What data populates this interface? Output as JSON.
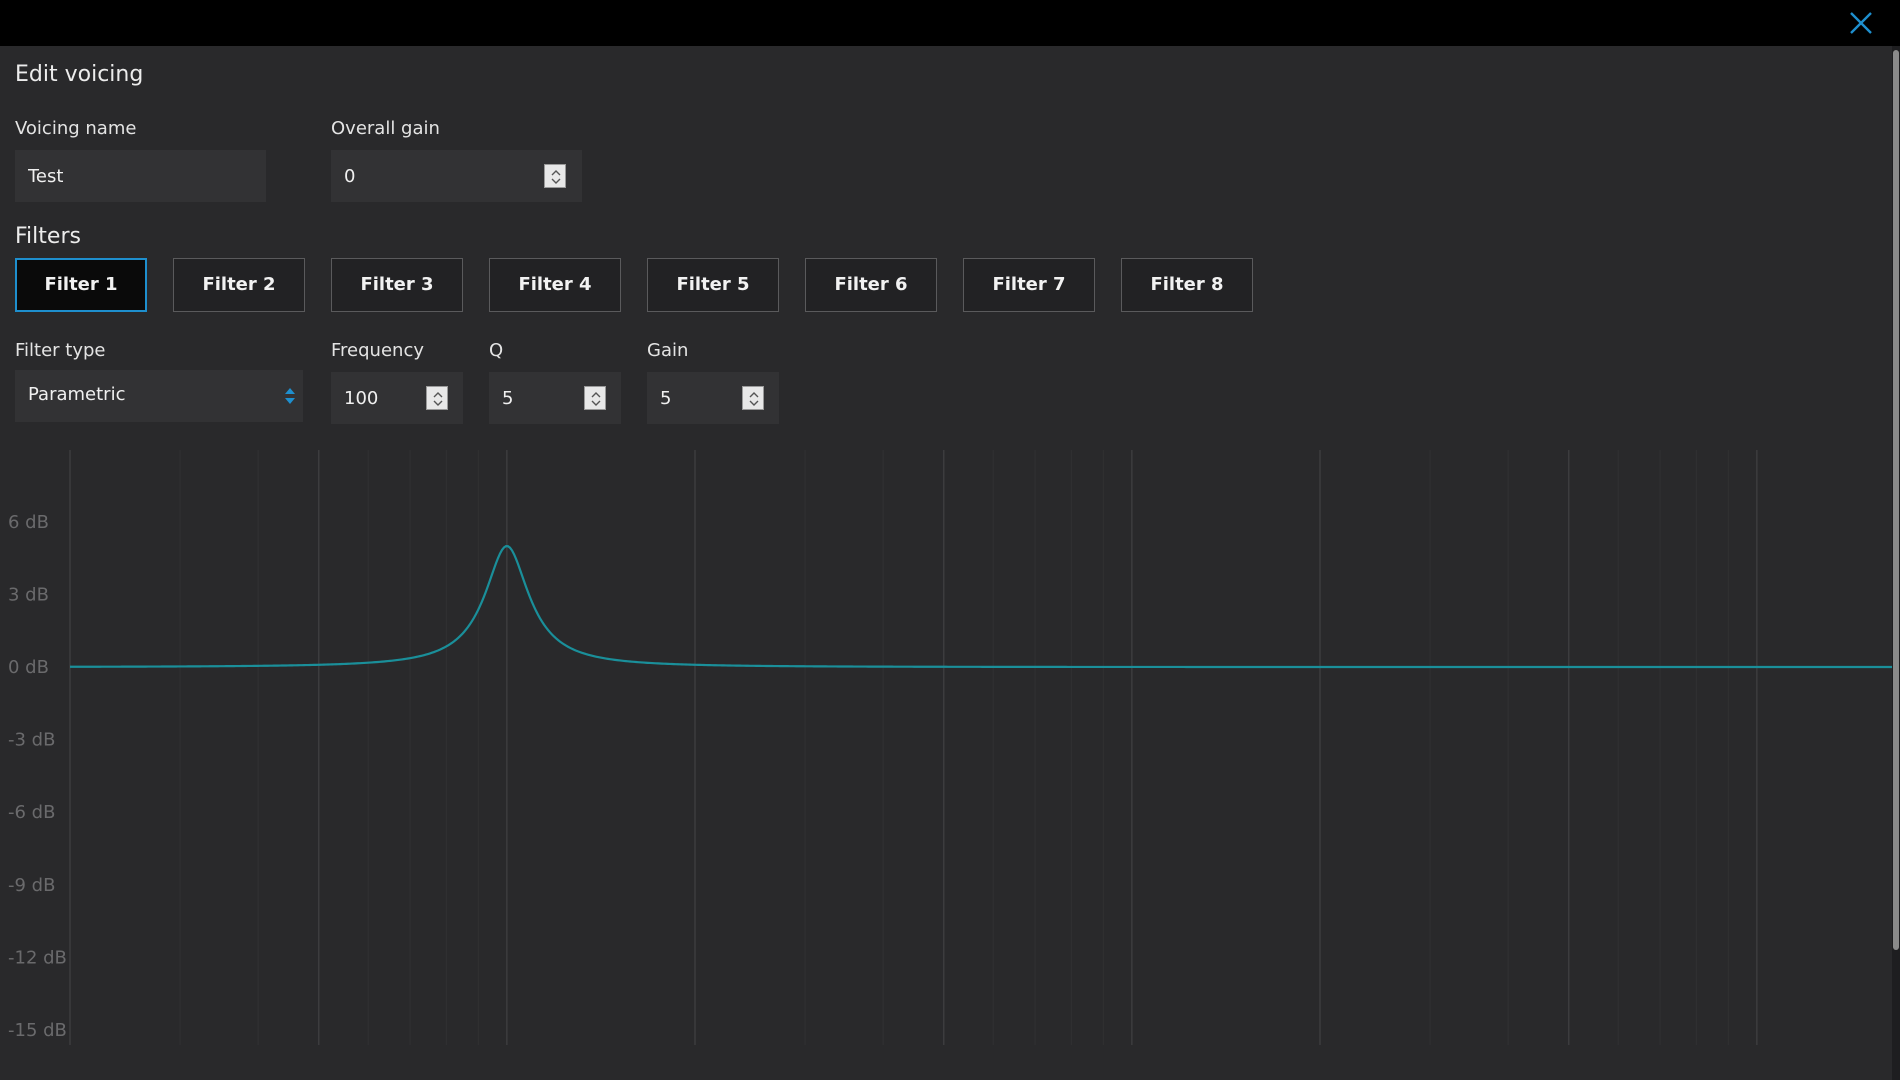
{
  "dialog": {
    "title": "Edit voicing",
    "close_icon": "close-icon"
  },
  "voicing": {
    "name_label": "Voicing name",
    "name_value": "Test",
    "gain_label": "Overall gain",
    "gain_value": "0"
  },
  "filters": {
    "heading": "Filters",
    "tabs": [
      {
        "label": "Filter 1",
        "active": true
      },
      {
        "label": "Filter 2",
        "active": false
      },
      {
        "label": "Filter 3",
        "active": false
      },
      {
        "label": "Filter 4",
        "active": false
      },
      {
        "label": "Filter 5",
        "active": false
      },
      {
        "label": "Filter 6",
        "active": false
      },
      {
        "label": "Filter 7",
        "active": false
      },
      {
        "label": "Filter 8",
        "active": false
      }
    ],
    "type_label": "Filter type",
    "type_value": "Parametric",
    "frequency_label": "Frequency",
    "frequency_value": "100",
    "q_label": "Q",
    "q_value": "5",
    "gain_label": "Gain",
    "gain_value": "5"
  },
  "colors": {
    "accent": "#1e8fce",
    "curve": "#1a8f9a",
    "background": "#29292b",
    "titlebar": "#000000"
  },
  "chart_data": {
    "type": "line",
    "x_scale": "log",
    "y_unit": "dB",
    "y_tick_labels": [
      "6 dB",
      "3 dB",
      "0 dB",
      "-3 dB",
      "-6 dB",
      "-9 dB",
      "-12 dB",
      "-15 dB"
    ],
    "y_ticks": [
      6,
      3,
      0,
      -3,
      -6,
      -9,
      -12,
      -15
    ],
    "ylim": [
      -15,
      8
    ],
    "xlim": [
      20,
      20000
    ],
    "grid": true,
    "series": [
      {
        "filter": "peaking",
        "center_frequency": 100,
        "q": 5,
        "gain_db": 5
      }
    ]
  }
}
